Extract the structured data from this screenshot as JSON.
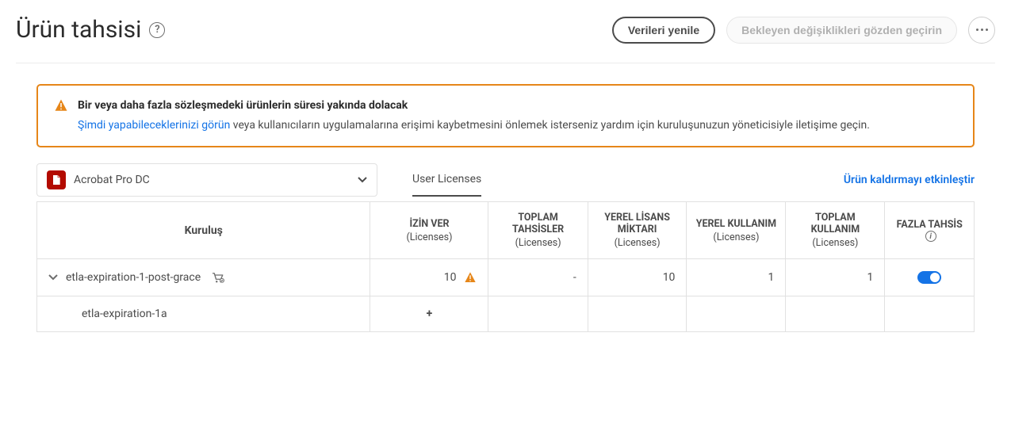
{
  "header": {
    "title": "Ürün tahsisi",
    "refresh": "Verileri yenile",
    "review": "Bekleyen değişiklikleri gözden geçirin"
  },
  "alert": {
    "title": "Bir veya daha fazla sözleşmedeki ürünlerin süresi yakında dolacak",
    "link": "Şimdi yapabileceklerinizi görün",
    "rest": " veya kullanıcıların uygulamalarına erişimi kaybetmesini önlemek isterseniz yardım için kuruluşunuzun yöneticisiyle iletişime geçin."
  },
  "product": {
    "name": "Acrobat Pro DC"
  },
  "tabs": {
    "userLicenses": "User Licenses"
  },
  "rightLink": "Ürün kaldırmayı etkinleştir",
  "columns": {
    "org": "Kuruluş",
    "grant": "İZİN VER",
    "totalAlloc": "TOPLAM TAHSİSLER",
    "localQty": "YEREL LİSANS MİKTARI",
    "localUse": "YEREL KULLANIM",
    "totalUse": "TOPLAM KULLANIM",
    "over": "FAZLA TAHSİS",
    "unit": "(Licenses)"
  },
  "rows": {
    "r0": {
      "name": "etla-expiration-1-post-grace",
      "grant": "10",
      "totalAlloc": "-",
      "localQty": "10",
      "localUse": "1",
      "totalUse": "1"
    },
    "r1": {
      "name": "etla-expiration-1a",
      "plus": "+"
    }
  }
}
